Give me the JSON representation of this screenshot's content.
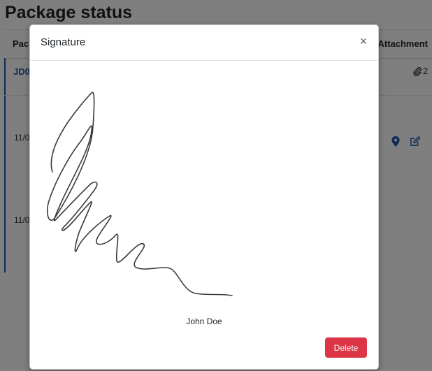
{
  "page": {
    "title": "Package status"
  },
  "table": {
    "headers": {
      "package": "Pack",
      "attachment": "Attachment"
    },
    "row_id": "JD0",
    "attachment_count": "2",
    "dates": [
      "11/0",
      "11/0"
    ]
  },
  "modal": {
    "title": "Signature",
    "close_label": "×",
    "signer_name": "John Doe",
    "delete_label": "Delete"
  },
  "colors": {
    "link": "#1f5aa8",
    "danger": "#dc3545",
    "backdrop": "rgba(0,0,0,0.5)"
  },
  "icons": {
    "attachment": "paperclip-icon",
    "location": "map-pin-icon",
    "edit": "edit-icon",
    "close": "close-icon"
  }
}
